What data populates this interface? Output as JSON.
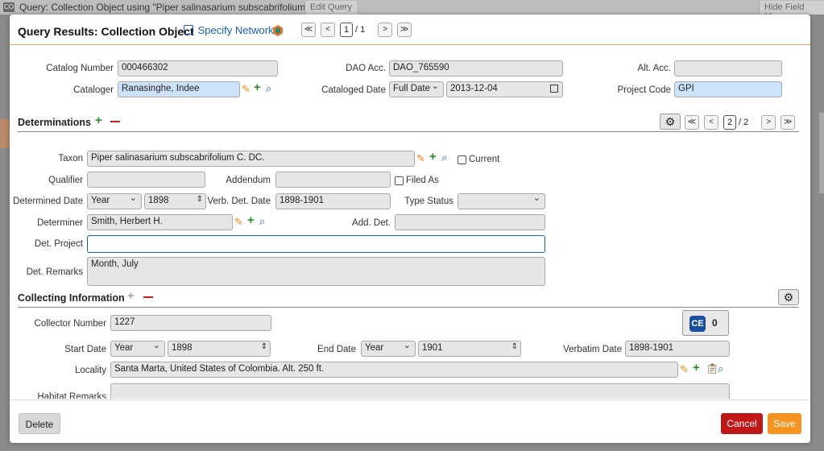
{
  "background": {
    "app_badge": "CO",
    "window_title": "Query: Collection Object using \"Piper salinasarium subscabrifolium",
    "tabs": [
      "Edit Query",
      "Hide Field Mapp"
    ]
  },
  "header": {
    "title": "Query Results: Collection Object",
    "specify_network": "Specify Network",
    "pager": {
      "first": "≪",
      "prev": "<",
      "current": "1",
      "total": "/ 1",
      "next": ">",
      "last": "≫"
    }
  },
  "collection_object": {
    "catalog_number": {
      "label": "Catalog Number",
      "value": "000466302"
    },
    "dao_acc": {
      "label": "DAO Acc.",
      "value": "DAO_765590"
    },
    "alt_acc": {
      "label": "Alt. Acc.",
      "value": ""
    },
    "cataloger": {
      "label": "Cataloger",
      "value": "Ranasinghe, Indee"
    },
    "cataloged_date": {
      "label": "Cataloged Date",
      "precision": "Full Date",
      "value": "2013-12-04"
    },
    "project_code": {
      "label": "Project Code",
      "value": "GPI"
    }
  },
  "determinations": {
    "title": "Determinations",
    "pager": {
      "first": "≪",
      "prev": "<",
      "current": "2",
      "total": "/ 2",
      "next": ">",
      "last": "≫"
    },
    "taxon": {
      "label": "Taxon",
      "value": "Piper salinasarium subscabrifolium C. DC."
    },
    "current_label": "Current",
    "qualifier": {
      "label": "Qualifier",
      "value": ""
    },
    "addendum": {
      "label": "Addendum",
      "value": ""
    },
    "filed_as_label": "Filed As",
    "determined_date": {
      "label": "Determined Date",
      "precision": "Year",
      "value": "1898"
    },
    "verb_det_date": {
      "label": "Verb. Det. Date",
      "value": "1898-1901"
    },
    "type_status": {
      "label": "Type Status",
      "value": ""
    },
    "determiner": {
      "label": "Determiner",
      "value": "Smith, Herbert  H."
    },
    "add_det": {
      "label": "Add. Det.",
      "value": ""
    },
    "det_project": {
      "label": "Det. Project",
      "value": ""
    },
    "det_remarks": {
      "label": "Det. Remarks",
      "value": "Month, July"
    }
  },
  "collecting": {
    "title": "Collecting Information",
    "collector_number": {
      "label": "Collector Number",
      "value": "1227"
    },
    "ce_badge": "CE",
    "ce_count": "0",
    "start_date": {
      "label": "Start Date",
      "precision": "Year",
      "value": "1898"
    },
    "end_date": {
      "label": "End Date",
      "precision": "Year",
      "value": "1901"
    },
    "verbatim_date": {
      "label": "Verbatim Date",
      "value": "1898-1901"
    },
    "locality": {
      "label": "Locality",
      "value": "Santa Marta, United States of Colombia. Alt. 250 ft."
    },
    "habitat_remarks": {
      "label": "Habitat Remarks",
      "value": ""
    }
  },
  "footer": {
    "delete": "Delete",
    "cancel": "Cancel",
    "save": "Save"
  },
  "colors": {
    "accent": "#f7931e",
    "link": "#1a5fc0",
    "danger": "#c01818",
    "add": "#2a8a2a"
  }
}
